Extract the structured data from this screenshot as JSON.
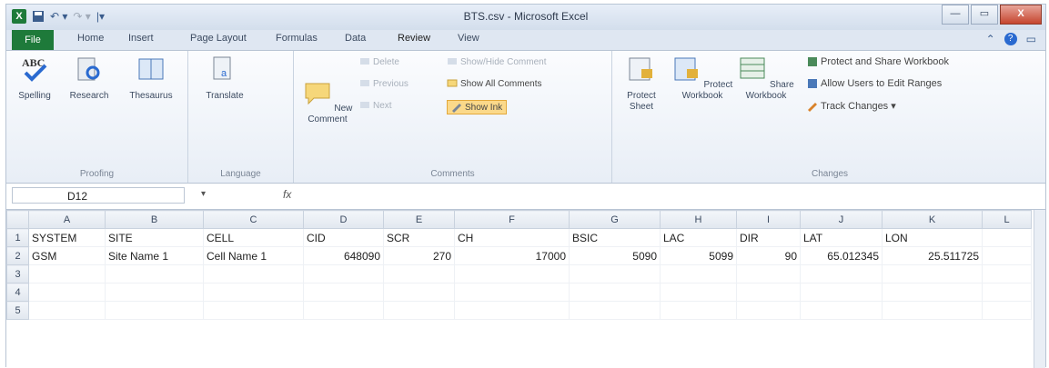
{
  "window": {
    "title": "BTS.csv - Microsoft Excel"
  },
  "qat": {
    "undo": "↶ ▾",
    "redo": "↷ ▾",
    "customize": "|▾"
  },
  "window_buttons": {
    "minimize": "—",
    "maximize": "▭",
    "close": "X"
  },
  "tabs": [
    "File",
    "Home",
    "Insert",
    "Page Layout",
    "Formulas",
    "Data",
    "Review",
    "View"
  ],
  "active_tab": "Review",
  "ribbon": {
    "proofing": {
      "label": "Proofing",
      "spelling": "Spelling",
      "research": "Research",
      "thesaurus": "Thesaurus"
    },
    "language": {
      "label": "Language",
      "translate": "Translate"
    },
    "comments": {
      "label": "Comments",
      "new_comment": "New Comment",
      "delete": "Delete",
      "previous": "Previous",
      "next": "Next",
      "show_hide": "Show/Hide Comment",
      "show_all": "Show All Comments",
      "show_ink": "Show Ink"
    },
    "changes": {
      "label": "Changes",
      "protect_sheet": "Protect Sheet",
      "protect_workbook": "Protect Workbook",
      "share_workbook": "Share Workbook",
      "protect_share": "Protect and Share Workbook",
      "allow_users": "Allow Users to Edit Ranges",
      "track_changes": "Track Changes ▾"
    }
  },
  "formula_bar": {
    "name_box": "D12",
    "fx": "fx",
    "value": ""
  },
  "columns": [
    "A",
    "B",
    "C",
    "D",
    "E",
    "F",
    "G",
    "H",
    "I",
    "J",
    "K",
    "L"
  ],
  "rows": [
    {
      "num": "1",
      "cells": [
        "SYSTEM",
        "SITE",
        "CELL",
        "CID",
        "SCR",
        "CH",
        "BSIC",
        "LAC",
        "DIR",
        "LAT",
        "LON",
        ""
      ]
    },
    {
      "num": "2",
      "cells": [
        "GSM",
        "Site Name 1",
        "Cell Name 1",
        "648090",
        "270",
        "17000",
        "5090",
        "5099",
        "90",
        "65.012345",
        "25.511725",
        ""
      ]
    },
    {
      "num": "3",
      "cells": [
        "",
        "",
        "",
        "",
        "",
        "",
        "",
        "",
        "",
        "",
        "",
        ""
      ]
    },
    {
      "num": "4",
      "cells": [
        "",
        "",
        "",
        "",
        "",
        "",
        "",
        "",
        "",
        "",
        "",
        ""
      ]
    },
    {
      "num": "5",
      "cells": [
        "",
        "",
        "",
        "",
        "",
        "",
        "",
        "",
        "",
        "",
        "",
        ""
      ]
    }
  ],
  "colors": {
    "excel_green": "#1e7a3a",
    "show_ink_highlight": "#fbd98a"
  }
}
